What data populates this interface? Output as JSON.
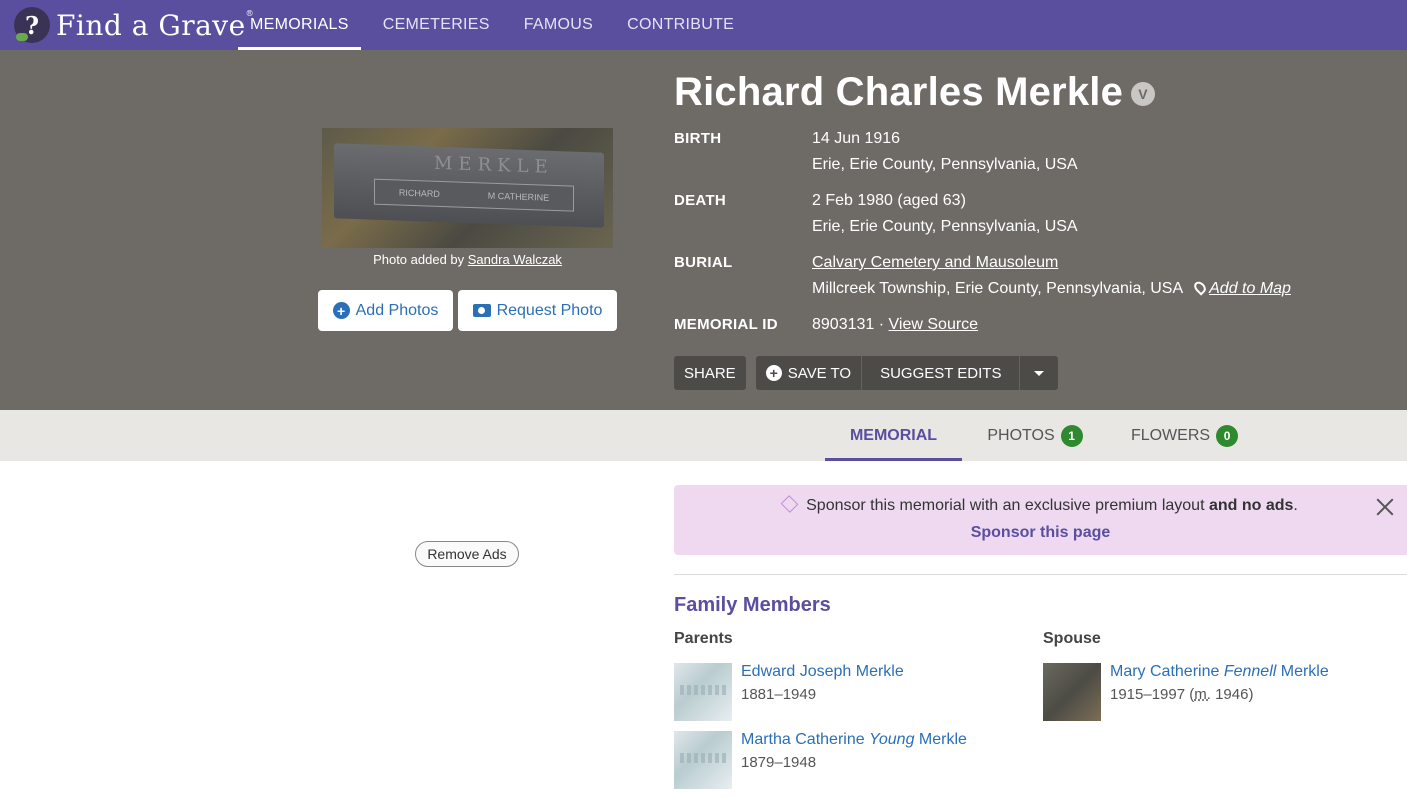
{
  "nav": {
    "logo_text": "Find a Grave",
    "logo_mark": "®",
    "items": [
      {
        "label": "MEMORIALS",
        "active": true
      },
      {
        "label": "CEMETERIES",
        "active": false
      },
      {
        "label": "FAMOUS",
        "active": false
      },
      {
        "label": "CONTRIBUTE",
        "active": false
      }
    ]
  },
  "memorial": {
    "name": "Richard Charles Merkle",
    "verified_badge": "V",
    "photo": {
      "headstone_surname": "MERKLE",
      "plate_left": "RICHARD",
      "plate_right": "M CATHERINE",
      "caption_prefix": "Photo added by",
      "caption_user": "Sandra Walczak"
    },
    "add_photos": "Add Photos",
    "request_photo": "Request Photo",
    "birth": {
      "label": "BIRTH",
      "date": "14 Jun 1916",
      "place": "Erie, Erie County, Pennsylvania, USA"
    },
    "death": {
      "label": "DEATH",
      "date": "2 Feb 1980 (aged 63)",
      "place": "Erie, Erie County, Pennsylvania, USA"
    },
    "burial": {
      "label": "BURIAL",
      "cemetery": "Calvary Cemetery and Mausoleum",
      "place": "Millcreek Township, Erie County, Pennsylvania, USA",
      "add_to_map": "Add to Map"
    },
    "memorial_id": {
      "label": "MEMORIAL ID",
      "value": "8903131",
      "separator": "·",
      "view_source": "View Source"
    }
  },
  "actions": {
    "share": "SHARE",
    "save_to": "SAVE TO",
    "suggest_edits": "SUGGEST EDITS"
  },
  "tabs": [
    {
      "label": "MEMORIAL",
      "active": true
    },
    {
      "label": "PHOTOS",
      "count": "1"
    },
    {
      "label": "FLOWERS",
      "count": "0"
    }
  ],
  "ads": {
    "remove_ads": "Remove Ads"
  },
  "sponsor": {
    "text": "Sponsor this memorial with an exclusive premium layout",
    "text_bold": "and no ads",
    "text_end": ".",
    "link": "Sponsor this page"
  },
  "family": {
    "title": "Family Members",
    "parents_label": "Parents",
    "spouse_label": "Spouse",
    "parents": [
      {
        "first": "Edward Joseph Merkle",
        "maiden": "",
        "last": "",
        "dates": "1881–1949"
      },
      {
        "first": "Martha Catherine",
        "maiden": "Young",
        "last": "Merkle",
        "dates": "1879–1948"
      }
    ],
    "spouse": {
      "first": "Mary Catherine",
      "maiden": "Fennell",
      "last": "Merkle",
      "dates": "1915–1997 (",
      "marriage_abbr": "m.",
      "marriage_year": " 1946)"
    }
  },
  "colors": {
    "nav_bg": "#5a4f9e",
    "hero_bg": "#6e6b66",
    "link": "#2a6fb8",
    "badge_green": "#2f8a2f",
    "sponsor_bg": "#efd9f1"
  }
}
